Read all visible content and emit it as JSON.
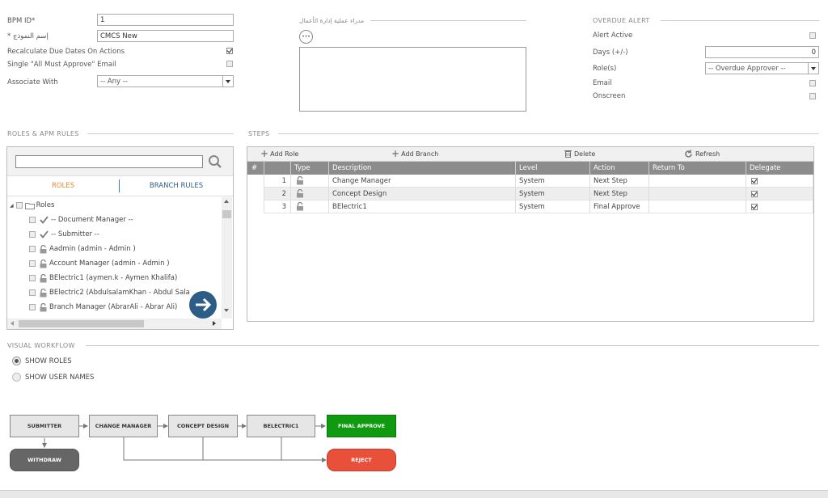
{
  "form": {
    "bpm_id_label": "BPM ID*",
    "bpm_id_value": "1",
    "model_name_label": "* إسم النموذج",
    "model_name_value": "CMCS New",
    "recalc_label": "Recalculate Due Dates On Actions",
    "single_email_label": "Single \"All Must Approve\" Email",
    "associate_label": "Associate With",
    "associate_value": "-- Any --"
  },
  "manager": {
    "title": "مدراء عملية إدارة الأعمال",
    "more": "•••"
  },
  "overdue": {
    "title": "OVERDUE ALERT",
    "alert_active": "Alert Active",
    "days_label": "Days (+/-)",
    "days_value": "0",
    "roles_label": "Role(s)",
    "roles_value": "-- Overdue Approver --",
    "email_label": "Email",
    "onscreen_label": "Onscreen"
  },
  "roles_panel": {
    "title": "ROLES & APM RULES",
    "tab_roles": "ROLES",
    "tab_branch": "BRANCH RULES",
    "root": "Roles",
    "items": [
      {
        "label": "-- Document Manager --",
        "icon": "check"
      },
      {
        "label": "-- Submitter --",
        "icon": "check"
      },
      {
        "label": "Aadmin (admin - Admin )",
        "icon": "lock"
      },
      {
        "label": "Account Manager (admin - Admin )",
        "icon": "lock"
      },
      {
        "label": "BElectric1 (aymen.k - Aymen Khalifa)",
        "icon": "lock"
      },
      {
        "label": "BElectric2 (AbdulsalamKhan - Abdul Sala",
        "icon": "lock"
      },
      {
        "label": "Branch Manager (AbrarAli - Abrar Ali)",
        "icon": "lock"
      }
    ]
  },
  "steps": {
    "title": "STEPS",
    "toolbar": {
      "add_role": "Add Role",
      "add_branch": "Add Branch",
      "delete": "Delete",
      "refresh": "Refresh"
    },
    "columns": [
      "#",
      "Type",
      "Description",
      "Level",
      "Action",
      "Return To",
      "Delegate"
    ],
    "rows": [
      {
        "num": "1",
        "description": "Change Manager",
        "level": "System",
        "action": "Next Step",
        "return_to": "",
        "delegate": true
      },
      {
        "num": "2",
        "description": "Concept Design",
        "level": "System",
        "action": "Next Step",
        "return_to": "",
        "delegate": true
      },
      {
        "num": "3",
        "description": "BElectric1",
        "level": "System",
        "action": "Final Approve",
        "return_to": "",
        "delegate": true
      }
    ]
  },
  "visual": {
    "title": "VISUAL WORKFLOW",
    "show_roles": "SHOW ROLES",
    "show_users": "SHOW USER NAMES",
    "nodes": {
      "submitter": "SUBMITTER",
      "change_manager": "CHANGE MANAGER",
      "concept_design": "CONCEPT DESIGN",
      "belectric1": "BELECTRIC1",
      "final_approve": "FINAL APPROVE",
      "withdraw": "WITHDRAW",
      "reject": "REJECT"
    }
  },
  "colors": {
    "table_header": "#8c8c8c",
    "final_approve": "#0f9a0f",
    "reject": "#e8503a",
    "withdraw": "#666666",
    "fab": "#2c5d87",
    "tab_active": "#e68a2e"
  }
}
